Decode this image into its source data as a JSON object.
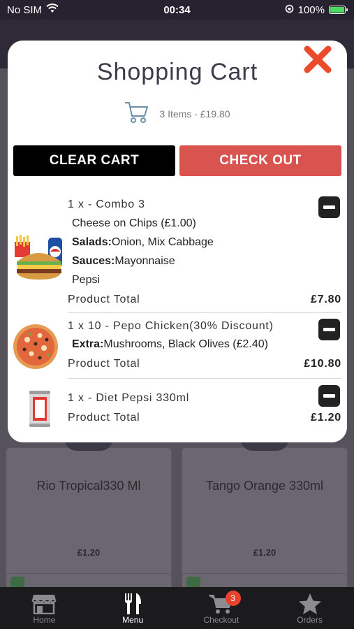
{
  "status_bar": {
    "carrier": "No SIM",
    "time": "00:34",
    "battery": "100%"
  },
  "background_products": [
    {
      "name": "Rio Tropical330 Ml",
      "price": "£1.20"
    },
    {
      "name": "Tango Orange 330ml",
      "price": "£1.20"
    }
  ],
  "modal": {
    "title": "Shopping Cart",
    "summary": "3 Items - £19.80",
    "clear_label": "CLEAR CART",
    "checkout_label": "CHECK OUT",
    "items": [
      {
        "title": "1 x - Combo 3",
        "lines": [
          {
            "label": "",
            "value": "Cheese on Chips (£1.00)"
          },
          {
            "label": "Salads:",
            "value": "Onion, Mix Cabbage"
          },
          {
            "label": "Sauces:",
            "value": "Mayonnaise"
          },
          {
            "label": "",
            "value": "Pepsi"
          }
        ],
        "total_label": "Product Total",
        "total": "£7.80"
      },
      {
        "title": "1 x 10 - Pepo Chicken(30% Discount)",
        "lines": [
          {
            "label": "Extra:",
            "value": "Mushrooms, Black Olives (£2.40)"
          }
        ],
        "total_label": "Product Total",
        "total": "£10.80"
      },
      {
        "title": "1 x - Diet Pepsi 330ml",
        "lines": [],
        "total_label": "Product Total",
        "total": "£1.20"
      }
    ]
  },
  "tabbar": {
    "tabs": [
      {
        "label": "Home",
        "icon": "store-icon"
      },
      {
        "label": "Menu",
        "icon": "fork-knife-icon"
      },
      {
        "label": "Checkout",
        "icon": "cart-icon",
        "badge": "3"
      },
      {
        "label": "Orders",
        "icon": "star-icon"
      }
    ]
  },
  "colors": {
    "close": "#ea4b2a",
    "checkout": "#d9534f",
    "badge": "#e8412d"
  }
}
